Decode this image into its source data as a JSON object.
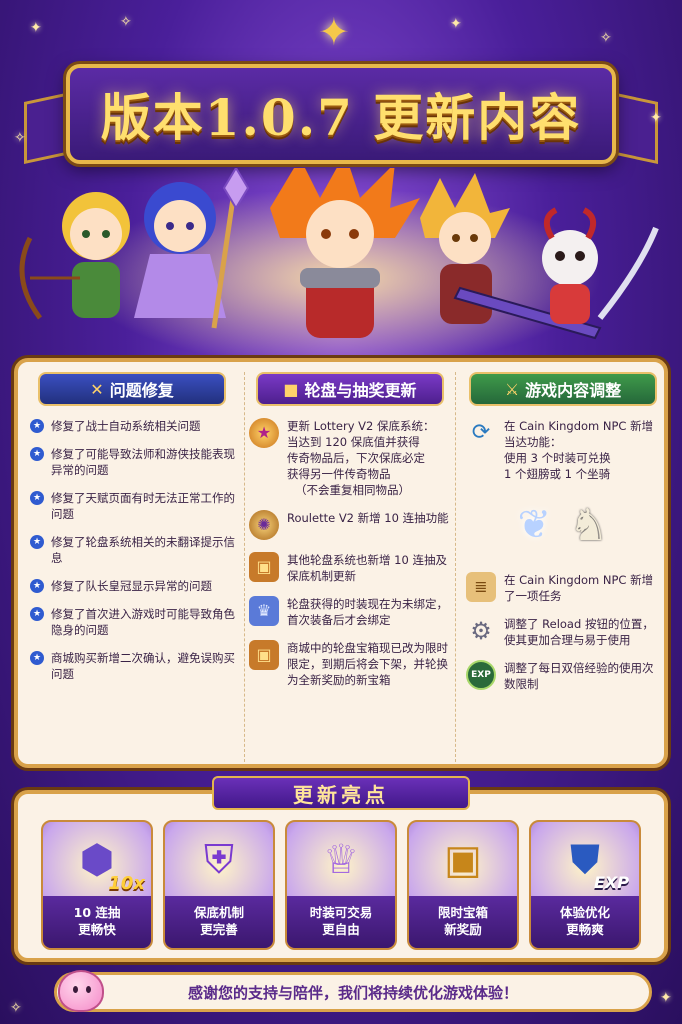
{
  "title": "版本1.0.7 更新内容",
  "columns": {
    "fixes": {
      "header": "问题修复",
      "icon": "wrench-icon",
      "items": [
        "修复了战士自动系统相关问题",
        "修复了可能导致法师和游侠技能表现异常的问题",
        "修复了天赋页面有时无法正常工作的问题",
        "修复了轮盘系统相关的未翻译提示信息",
        "修复了队长皇冠显示异常的问题",
        "修复了首次进入游戏时可能导致角色隐身的问题",
        "商城购买新增二次确认，避免误购买问题"
      ]
    },
    "lottery": {
      "header": "轮盘与抽奖更新",
      "icon": "gift-icon",
      "item1": {
        "line1": "更新 Lottery V2 保底系统：",
        "line2": "当达到 120 保底值并获得",
        "line3": "传奇物品后，下次保底必定",
        "line4": "获得另一件传奇物品",
        "line5": "（不会重复相同物品）"
      },
      "item2": "Roulette V2 新增 10 连抽功能",
      "item3": "其他轮盘系统也新增 10 连抽及保底机制更新",
      "item4": "轮盘获得的时装现在为未绑定，首次装备后才会绑定",
      "item5": "商城中的轮盘宝箱现已改为限时限定，到期后将会下架，并轮换为全新奖励的新宝箱"
    },
    "content": {
      "header": "游戏内容调整",
      "icon": "crossed-swords-icon",
      "item1": {
        "line1": "在 Cain Kingdom NPC 新增",
        "line2": "当达功能：",
        "line3": "使用 3 个时装可兑换",
        "line4": "1 个翅膀或 1 个坐骑"
      },
      "item2": "在 Cain Kingdom NPC 新增了一项任务",
      "item3": "调整了 Reload 按钮的位置，使其更加合理与易于使用",
      "item4": "调整了每日双倍经验的使用次数限制",
      "exp_badge": "EXP"
    }
  },
  "highlights": {
    "title": "更新亮点",
    "cards": [
      {
        "line1": "10 连抽",
        "line2": "更畅快",
        "badge": "10x",
        "icon": "gem-capsule-icon"
      },
      {
        "line1": "保底机制",
        "line2": "更完善",
        "icon": "shield-star-icon"
      },
      {
        "line1": "时装可交易",
        "line2": "更自由",
        "icon": "dress-icon"
      },
      {
        "line1": "限时宝箱",
        "line2": "新奖励",
        "icon": "treasure-chest-icon"
      },
      {
        "line1": "体验优化",
        "line2": "更畅爽",
        "badge": "EXP",
        "icon": "exp-shield-icon"
      }
    ]
  },
  "footer": "感谢您的支持与陪伴，我们将持续优化游戏体验！",
  "colors": {
    "background": "#4a1f9a",
    "gold": "#e8b84a",
    "panel": "#fbf2e6"
  }
}
